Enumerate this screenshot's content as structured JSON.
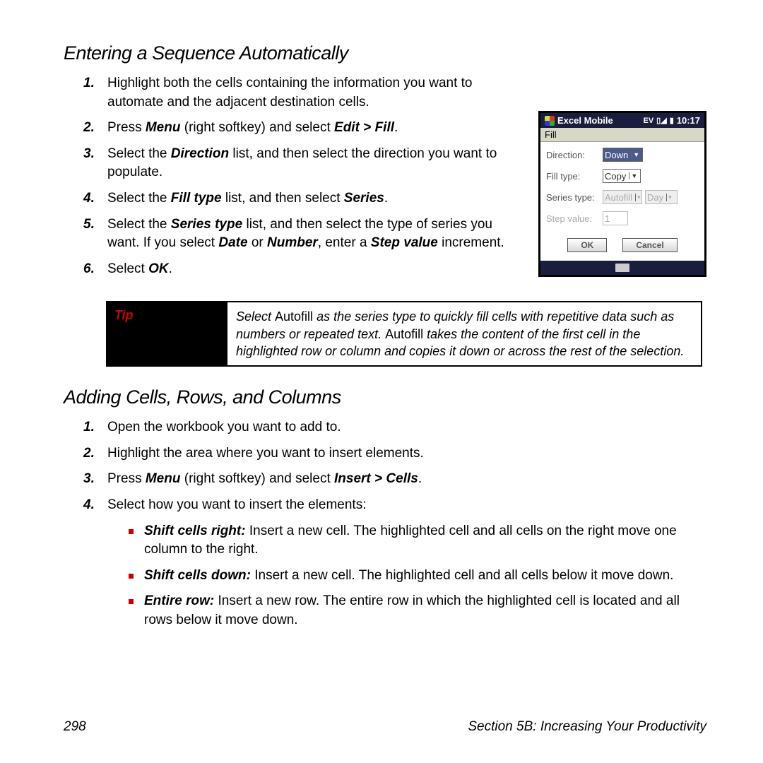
{
  "section1": {
    "title": "Entering a Sequence Automatically",
    "steps": [
      {
        "num": "1",
        "text": "Highlight both the cells containing the information you want to automate and the adjacent destination cells."
      },
      {
        "num": "2",
        "pre": "Press ",
        "b1": "Menu",
        "mid": " (right softkey) and select ",
        "b2": "Edit",
        "gt": " > ",
        "b3": "Fill",
        "post": "."
      },
      {
        "num": "3",
        "pre": "Select the ",
        "b1": "Direction",
        "post": " list, and then select the direction you want to populate."
      },
      {
        "num": "4",
        "pre": "Select the ",
        "b1": "Fill type",
        "mid": " list, and then select ",
        "b2": "Series",
        "post": "."
      },
      {
        "num": "5",
        "pre": "Select the ",
        "b1": "Series type",
        "mid": " list, and then select the type of series you want. If you select ",
        "b2": "Date",
        "mid2": " or ",
        "b3": "Number",
        "mid3": ", enter a ",
        "b4": "Step value",
        "post": " increment."
      },
      {
        "num": "6",
        "pre": "Select ",
        "b1": "OK",
        "post": "."
      }
    ]
  },
  "device": {
    "title": "Excel Mobile",
    "status_ev": "EV",
    "status_time": "10:17",
    "subheader": "Fill",
    "rows": {
      "direction_label": "Direction:",
      "direction_value": "Down",
      "filltype_label": "Fill type:",
      "filltype_value": "Copy",
      "seriestype_label": "Series type:",
      "seriestype_value": "Autofill",
      "seriestype_b": "Day",
      "step_label": "Step value:",
      "step_value": "1"
    },
    "ok": "OK",
    "cancel": "Cancel"
  },
  "tip": {
    "label": "Tip",
    "t1": "Select ",
    "b1": "Autofill",
    "t2": " as the series type to quickly fill cells with repetitive data such as numbers or repeated text. ",
    "b2": "Autofill",
    "t3": " takes the content of the first cell in the highlighted row or column and copies it down or across the rest of the selection."
  },
  "section2": {
    "title": "Adding Cells, Rows, and Columns",
    "steps": [
      {
        "num": "1",
        "text": "Open the workbook you want to add to."
      },
      {
        "num": "2",
        "text": "Highlight the area where you want to insert elements."
      },
      {
        "num": "3",
        "pre": "Press ",
        "b1": "Menu",
        "mid": " (right softkey) and select ",
        "b2": "Insert",
        "gt": " > ",
        "b3": "Cells",
        "post": "."
      },
      {
        "num": "4",
        "text": "Select how you want to insert the elements:"
      }
    ],
    "bullets": [
      {
        "b": "Shift cells right:",
        "t": " Insert a new cell. The highlighted cell and all cells on the right move one column to the right."
      },
      {
        "b": "Shift cells down:",
        "t": " Insert a new cell. The highlighted cell and all cells below it move down."
      },
      {
        "b": "Entire row:",
        "t": " Insert a new row. The entire row in which the highlighted cell is located and all rows below it move down."
      }
    ]
  },
  "footer": {
    "page": "298",
    "section": "Section 5B: Increasing Your Productivity"
  }
}
